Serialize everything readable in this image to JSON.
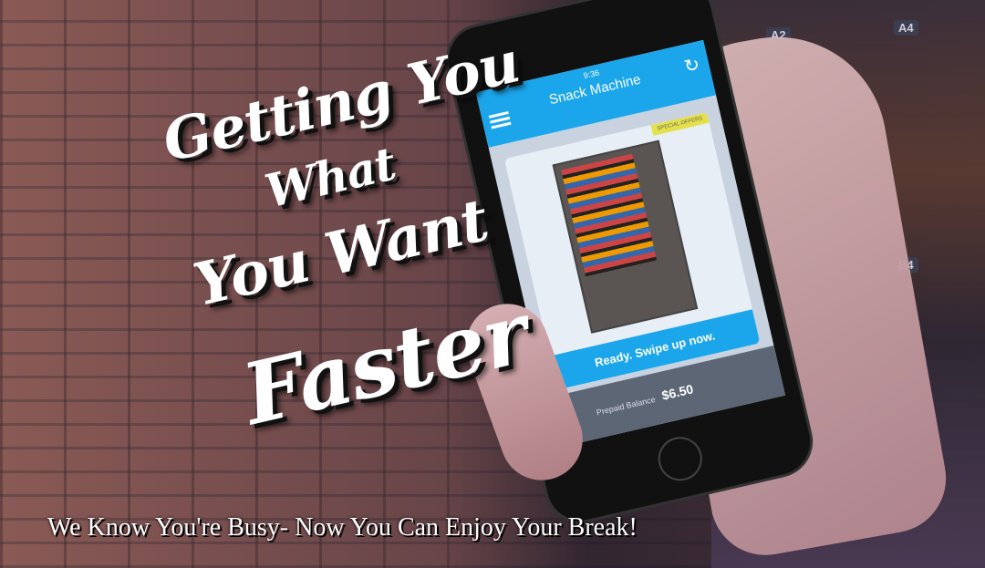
{
  "headline": {
    "line1": "Getting You",
    "line2": "What",
    "line3": "You Want",
    "line4": "Faster"
  },
  "tagline": "We Know You're Busy- Now You Can Enjoy Your Break!",
  "background_slots": [
    "A2",
    "A4",
    "B4"
  ],
  "phone": {
    "time": "9:36",
    "title": "Snack Machine",
    "menu_icon": "hamburger-icon",
    "refresh_icon": "refresh-icon",
    "badge": "SPECIAL OFFERS",
    "cta": "Ready. Swipe up now.",
    "balance_label": "Prepaid Balance",
    "balance_value": "$6.50",
    "accent": "#1ba6ec"
  }
}
